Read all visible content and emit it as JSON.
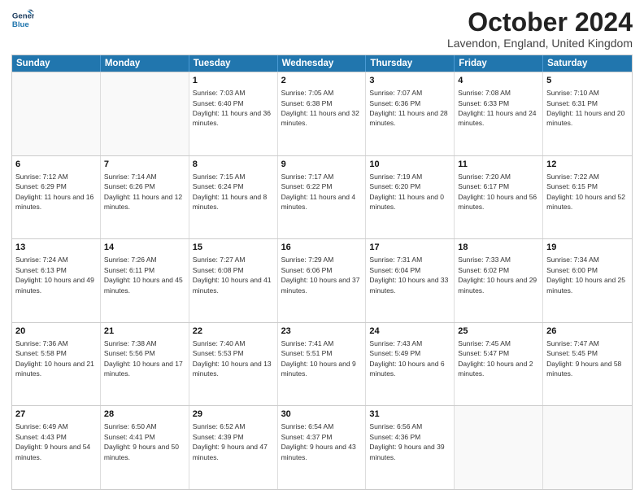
{
  "header": {
    "logo_line1": "General",
    "logo_line2": "Blue",
    "month": "October 2024",
    "location": "Lavendon, England, United Kingdom"
  },
  "days_of_week": [
    "Sunday",
    "Monday",
    "Tuesday",
    "Wednesday",
    "Thursday",
    "Friday",
    "Saturday"
  ],
  "weeks": [
    [
      {
        "day": "",
        "info": ""
      },
      {
        "day": "",
        "info": ""
      },
      {
        "day": "1",
        "info": "Sunrise: 7:03 AM\nSunset: 6:40 PM\nDaylight: 11 hours and 36 minutes."
      },
      {
        "day": "2",
        "info": "Sunrise: 7:05 AM\nSunset: 6:38 PM\nDaylight: 11 hours and 32 minutes."
      },
      {
        "day": "3",
        "info": "Sunrise: 7:07 AM\nSunset: 6:36 PM\nDaylight: 11 hours and 28 minutes."
      },
      {
        "day": "4",
        "info": "Sunrise: 7:08 AM\nSunset: 6:33 PM\nDaylight: 11 hours and 24 minutes."
      },
      {
        "day": "5",
        "info": "Sunrise: 7:10 AM\nSunset: 6:31 PM\nDaylight: 11 hours and 20 minutes."
      }
    ],
    [
      {
        "day": "6",
        "info": "Sunrise: 7:12 AM\nSunset: 6:29 PM\nDaylight: 11 hours and 16 minutes."
      },
      {
        "day": "7",
        "info": "Sunrise: 7:14 AM\nSunset: 6:26 PM\nDaylight: 11 hours and 12 minutes."
      },
      {
        "day": "8",
        "info": "Sunrise: 7:15 AM\nSunset: 6:24 PM\nDaylight: 11 hours and 8 minutes."
      },
      {
        "day": "9",
        "info": "Sunrise: 7:17 AM\nSunset: 6:22 PM\nDaylight: 11 hours and 4 minutes."
      },
      {
        "day": "10",
        "info": "Sunrise: 7:19 AM\nSunset: 6:20 PM\nDaylight: 11 hours and 0 minutes."
      },
      {
        "day": "11",
        "info": "Sunrise: 7:20 AM\nSunset: 6:17 PM\nDaylight: 10 hours and 56 minutes."
      },
      {
        "day": "12",
        "info": "Sunrise: 7:22 AM\nSunset: 6:15 PM\nDaylight: 10 hours and 52 minutes."
      }
    ],
    [
      {
        "day": "13",
        "info": "Sunrise: 7:24 AM\nSunset: 6:13 PM\nDaylight: 10 hours and 49 minutes."
      },
      {
        "day": "14",
        "info": "Sunrise: 7:26 AM\nSunset: 6:11 PM\nDaylight: 10 hours and 45 minutes."
      },
      {
        "day": "15",
        "info": "Sunrise: 7:27 AM\nSunset: 6:08 PM\nDaylight: 10 hours and 41 minutes."
      },
      {
        "day": "16",
        "info": "Sunrise: 7:29 AM\nSunset: 6:06 PM\nDaylight: 10 hours and 37 minutes."
      },
      {
        "day": "17",
        "info": "Sunrise: 7:31 AM\nSunset: 6:04 PM\nDaylight: 10 hours and 33 minutes."
      },
      {
        "day": "18",
        "info": "Sunrise: 7:33 AM\nSunset: 6:02 PM\nDaylight: 10 hours and 29 minutes."
      },
      {
        "day": "19",
        "info": "Sunrise: 7:34 AM\nSunset: 6:00 PM\nDaylight: 10 hours and 25 minutes."
      }
    ],
    [
      {
        "day": "20",
        "info": "Sunrise: 7:36 AM\nSunset: 5:58 PM\nDaylight: 10 hours and 21 minutes."
      },
      {
        "day": "21",
        "info": "Sunrise: 7:38 AM\nSunset: 5:56 PM\nDaylight: 10 hours and 17 minutes."
      },
      {
        "day": "22",
        "info": "Sunrise: 7:40 AM\nSunset: 5:53 PM\nDaylight: 10 hours and 13 minutes."
      },
      {
        "day": "23",
        "info": "Sunrise: 7:41 AM\nSunset: 5:51 PM\nDaylight: 10 hours and 9 minutes."
      },
      {
        "day": "24",
        "info": "Sunrise: 7:43 AM\nSunset: 5:49 PM\nDaylight: 10 hours and 6 minutes."
      },
      {
        "day": "25",
        "info": "Sunrise: 7:45 AM\nSunset: 5:47 PM\nDaylight: 10 hours and 2 minutes."
      },
      {
        "day": "26",
        "info": "Sunrise: 7:47 AM\nSunset: 5:45 PM\nDaylight: 9 hours and 58 minutes."
      }
    ],
    [
      {
        "day": "27",
        "info": "Sunrise: 6:49 AM\nSunset: 4:43 PM\nDaylight: 9 hours and 54 minutes."
      },
      {
        "day": "28",
        "info": "Sunrise: 6:50 AM\nSunset: 4:41 PM\nDaylight: 9 hours and 50 minutes."
      },
      {
        "day": "29",
        "info": "Sunrise: 6:52 AM\nSunset: 4:39 PM\nDaylight: 9 hours and 47 minutes."
      },
      {
        "day": "30",
        "info": "Sunrise: 6:54 AM\nSunset: 4:37 PM\nDaylight: 9 hours and 43 minutes."
      },
      {
        "day": "31",
        "info": "Sunrise: 6:56 AM\nSunset: 4:36 PM\nDaylight: 9 hours and 39 minutes."
      },
      {
        "day": "",
        "info": ""
      },
      {
        "day": "",
        "info": ""
      }
    ]
  ]
}
